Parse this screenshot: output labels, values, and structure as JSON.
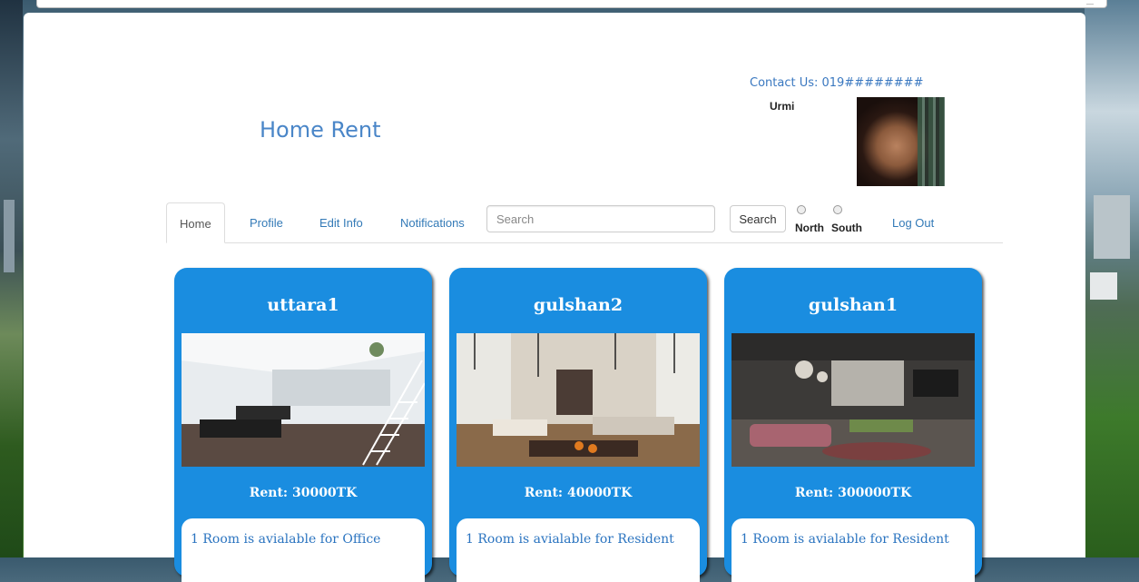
{
  "brand": {
    "title": "Home Rent"
  },
  "contact": {
    "text": "Contact Us: 019########"
  },
  "user": {
    "name": "Urmi"
  },
  "nav": {
    "tabs": [
      {
        "label": "Home",
        "active": true
      },
      {
        "label": "Profile"
      },
      {
        "label": "Edit Info"
      },
      {
        "label": "Notifications"
      }
    ],
    "search_placeholder": "Search",
    "search_button": "Search",
    "radio_north": "North",
    "radio_south": "South",
    "logout": "Log Out"
  },
  "listings": [
    {
      "title": "uttara1",
      "rent": "Rent: 30000TK",
      "description": "1 Room is avialable for Office"
    },
    {
      "title": "gulshan2",
      "rent": "Rent: 40000TK",
      "description": "1 Room is avialable for Resident"
    },
    {
      "title": "gulshan1",
      "rent": "Rent: 300000TK",
      "description": "1 Room is avialable for Resident"
    }
  ],
  "colors": {
    "card": "#1a8de0",
    "link": "#337ab7",
    "brand": "#4a86c8"
  }
}
